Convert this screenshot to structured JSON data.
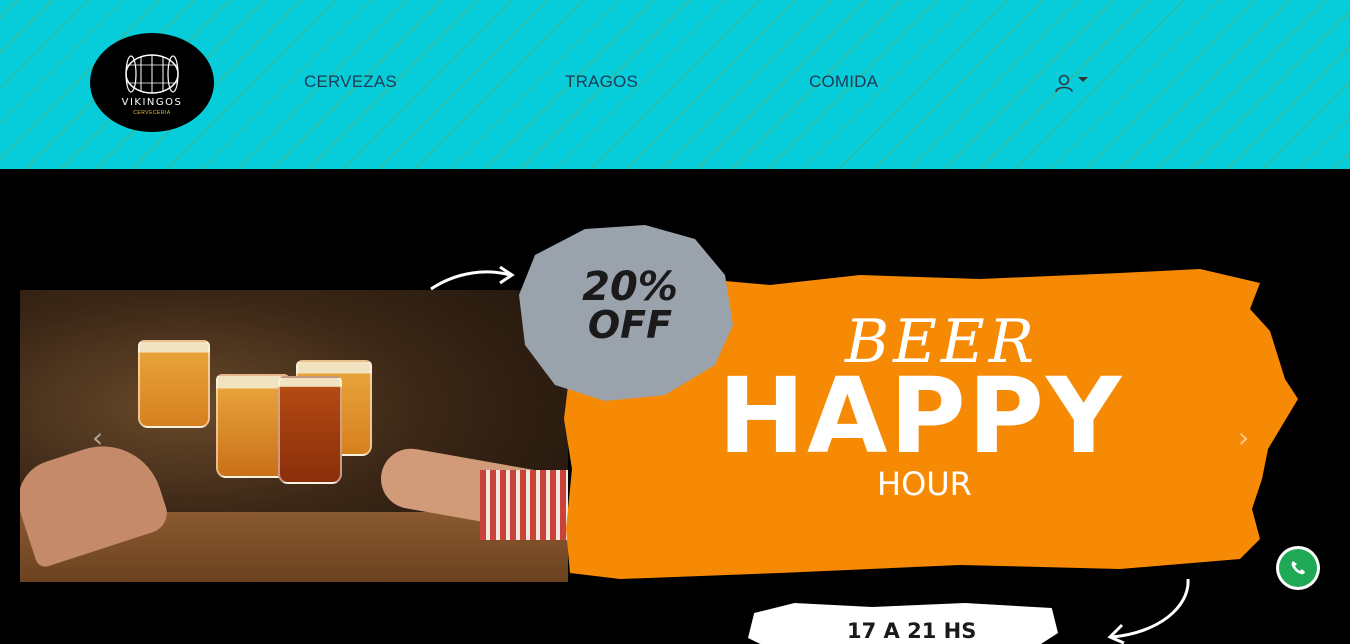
{
  "brand": {
    "name": "VIKINGOS",
    "subtitle": "CERVECERIA",
    "logo_icon": "barrel-icon"
  },
  "nav": {
    "items": [
      {
        "label": "CERVEZAS"
      },
      {
        "label": "TRAGOS"
      },
      {
        "label": "COMIDA"
      }
    ],
    "user_icon": "user-icon",
    "user_dropdown_icon": "caret-down-icon"
  },
  "hero": {
    "discount_line1": "20%",
    "discount_line2": "OFF",
    "beer": "BEER",
    "happy": "HAPPY",
    "hour": "HOUR",
    "hours": "17 A 21 HS",
    "prev_icon": "chevron-left-icon",
    "next_icon": "chevron-right-icon"
  },
  "floating": {
    "whatsapp_icon": "whatsapp-icon"
  },
  "colors": {
    "navbar_bg": "#06cdd9",
    "accent_orange": "#f78a05",
    "splash_gray": "#9aa2ac",
    "nav_text": "#1f3a5a"
  }
}
